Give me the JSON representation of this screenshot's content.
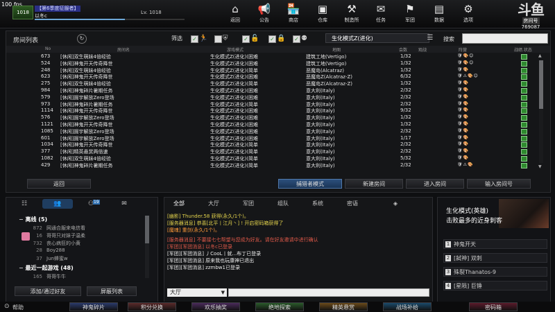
{
  "fps": "100 fps",
  "profile": {
    "rank": "1018",
    "guild": "【第6季度征服者】",
    "name": "以冬c",
    "level": "Lv. 1018"
  },
  "nav": [
    {
      "label": "返回",
      "icon": "home-icon",
      "glyph": "⌂"
    },
    {
      "label": "公告",
      "icon": "megaphone-icon",
      "glyph": "📢"
    },
    {
      "label": "商店",
      "icon": "shop-icon",
      "glyph": "🏪"
    },
    {
      "label": "仓库",
      "icon": "warehouse-icon",
      "glyph": "▣"
    },
    {
      "label": "制造所",
      "icon": "factory-icon",
      "glyph": "⚒"
    },
    {
      "label": "任务",
      "icon": "quest-icon",
      "glyph": "✉"
    },
    {
      "label": "军团",
      "icon": "legion-icon",
      "glyph": "⚑"
    },
    {
      "label": "数据",
      "icon": "data-icon",
      "glyph": "▤"
    },
    {
      "label": "选项",
      "icon": "gear-icon",
      "glyph": "⚙"
    }
  ],
  "logo": {
    "text": "斗鱼",
    "room_label": "房间号",
    "room_number": "769087"
  },
  "room_list": {
    "title": "房间列表",
    "filter_label": "筛选",
    "mode_selected": "生化模式Z(进化)",
    "search_label": "搜索",
    "columns": [
      "No",
      "房间名",
      "游戏模式",
      "地图",
      "会数",
      "观战",
      "阵营",
      "战绩.状态"
    ],
    "rows": [
      {
        "no": "673",
        "name": "[休闲]双生萌妹4倍经验",
        "mode": "生化模式Z(进化)(困难",
        "map": "建筑工地(Vertigo)",
        "count": "1/32"
      },
      {
        "no": "524",
        "name": "[休闲]神鬼开天传奇降世",
        "mode": "生化模式Z(进化)(困难",
        "map": "建筑工地(Vertigo)",
        "count": "1/32"
      },
      {
        "no": "248",
        "name": "[休闲]双生萌妹4倍经验",
        "mode": "生化模式Z(进化)(简单",
        "map": "恶魔岛(Alcatraz)",
        "count": "1/32"
      },
      {
        "no": "623",
        "name": "[休闲]神鬼开天传奇降世",
        "mode": "生化模式Z(进化)(困难",
        "map": "恶魔岛Z(Alcatraz-Z)",
        "count": "6/32"
      },
      {
        "no": "275",
        "name": "[休闲]双生萌妹4倍经验",
        "mode": "生化模式Z(进化)(简单",
        "map": "恶魔岛Z(Alcatraz-Z)",
        "count": "1/32"
      },
      {
        "no": "984",
        "name": "[休闲]神鬼碎片暑期任务",
        "mode": "生化模式Z(进化)(困难",
        "map": "意大利(Italy)",
        "count": "2/32"
      },
      {
        "no": "579",
        "name": "[休闲]掘宇解放Zero登场",
        "mode": "生化模式Z(进化)(困难",
        "map": "意大利(Italy)",
        "count": "2/32"
      },
      {
        "no": "973",
        "name": "[休闲]神鬼碎片暑期任务",
        "mode": "生化模式Z(进化)(简单",
        "map": "意大利(Italy)",
        "count": "2/32"
      },
      {
        "no": "1114",
        "name": "[休闲]神鬼开天传奇降世",
        "mode": "生化模式Z(进化)(困难",
        "map": "意大利(Italy)",
        "count": "9/32"
      },
      {
        "no": "576",
        "name": "[休闲]掘宇解放Zero登场",
        "mode": "生化模式Z(进化)(困难",
        "map": "意大利(Italy)",
        "count": "1/32"
      },
      {
        "no": "1121",
        "name": "[休闲]神鬼开天传奇降世",
        "mode": "生化模式Z(进化)(困难",
        "map": "意大利(Italy)",
        "count": "1/32"
      },
      {
        "no": "1085",
        "name": "[休闲]掘宇解放Zero登场",
        "mode": "生化模式Z(进化)(困难",
        "map": "意大利(Italy)",
        "count": "2/32"
      },
      {
        "no": "601",
        "name": "[休闲]掘宇解放Zero登场",
        "mode": "生化模式Z(进化)(困难",
        "map": "意大利(Italy)",
        "count": "1/17"
      },
      {
        "no": "1034",
        "name": "[休闲]神鬼开天传奇降世",
        "mode": "生化模式Z(进化)(简单",
        "map": "意大利(Italy)",
        "count": "2/32"
      },
      {
        "no": "377",
        "name": "[休闲]精英悬赏两倍速",
        "mode": "生化模式Z(进化)(简单",
        "map": "意大利(Italy)",
        "count": "2/32"
      },
      {
        "no": "1082",
        "name": "[休闲]双生萌妹4倍经验",
        "mode": "生化模式Z(进化)(简单",
        "map": "意大利(Italy)",
        "count": "5/32"
      },
      {
        "no": "429",
        "name": "[休闲]神鬼碎片暑期任务",
        "mode": "生化模式Z(进化)(简单",
        "map": "意大利(Italy)",
        "count": "2/32"
      }
    ],
    "buttons": {
      "back": "返回",
      "hunter": "捕猎者模式",
      "create": "新建房间",
      "enter": "进入房间",
      "enter_number": "输入房间号"
    }
  },
  "friends": {
    "tab_badge": "19",
    "group1": {
      "name": "离线",
      "count": "(5)"
    },
    "group1_items": [
      {
        "lv": "872",
        "name": "网通合服来电信看"
      },
      {
        "lv": "16",
        "name": "哥哥只对妹子温柔"
      },
      {
        "lv": "732",
        "name": "丧心病狂的小黄"
      },
      {
        "lv": "28",
        "name": "Boy288"
      },
      {
        "lv": "37",
        "name": "Jun蜂蜜w"
      }
    ],
    "group2": {
      "name": "最近一起游戏",
      "count": "(48)"
    },
    "group2_items": [
      {
        "lv": "165",
        "name": "哥哥牛牛"
      }
    ],
    "add_btn": "添加/通过好友",
    "block_btn": "屏蔽列表"
  },
  "chat": {
    "tabs": [
      "全部",
      "大厅",
      "军团",
      "组队",
      "系统",
      "密语"
    ],
    "lines": [
      {
        "text": "[幽影] Thunder.58 获得(永久/1个)。",
        "color": "y"
      },
      {
        "text": "[服务器消息] 恭喜[北平丨江月丶] ! 开启密码箱获得了",
        "color": "y"
      },
      {
        "text": "[魔魂] 重剑(永久/1个)。",
        "color": "o"
      },
      {
        "text": "[服务器消息] 不要接七七帮望与您成为好友。请在好友邀请中进行确认",
        "color": "r"
      },
      {
        "text": "[军团][军团消息] 以冬c已登录",
        "color": "r"
      },
      {
        "text": "[军团][军团消息] 丿CooL丨就...布丁已登录",
        "color": "w"
      },
      {
        "text": "[军团][军团消息] 原来我也玩康神已退出",
        "color": "w"
      },
      {
        "text": "[军团][军团消息] zzmbw1已登录",
        "color": "w"
      }
    ],
    "channel": "大厅"
  },
  "mission": {
    "title": "生化模式(英雄)",
    "subtitle": "击败最多的近身刺客",
    "items": [
      {
        "n": "1",
        "text": "神鬼开天"
      },
      {
        "n": "2",
        "text": "[弑神] 双刺"
      },
      {
        "n": "3",
        "text": "殊裂Thanatos-9"
      },
      {
        "n": "4",
        "text": "[星陨] 巨锤"
      }
    ]
  },
  "bottom": {
    "help": "帮助",
    "buttons": [
      {
        "label": "神鬼碎片",
        "color": "#2a3a6a"
      },
      {
        "label": "积分兑换",
        "color": "#5a2a2a"
      },
      {
        "label": "欢乐抽奖",
        "color": "#4a2a5a"
      },
      {
        "label": "绝地探索",
        "color": "#2a5a2a"
      },
      {
        "label": "精英悬赏",
        "color": "#6a4a1a"
      },
      {
        "label": "战场补给",
        "color": "#1a4a6a"
      },
      {
        "label": "密码箱",
        "color": "#5a1a2a"
      }
    ]
  }
}
